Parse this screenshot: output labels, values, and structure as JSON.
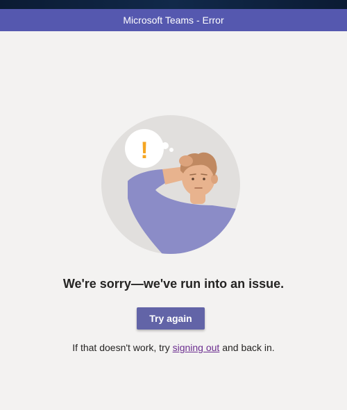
{
  "window": {
    "title": "Microsoft Teams - Error"
  },
  "illustration": {
    "icon": "confused-person-illustration",
    "bubble_glyph": "!"
  },
  "error": {
    "heading": "We're sorry—we've run into an issue.",
    "retry_button_label": "Try again",
    "helper_prefix": "If that doesn't work, try ",
    "helper_link": "signing out",
    "helper_suffix": " and back in."
  },
  "colors": {
    "titlebar": "#5558af",
    "button": "#6264a7",
    "link": "#6b2d8f",
    "background": "#f3f2f1",
    "alert": "#f5a623"
  }
}
